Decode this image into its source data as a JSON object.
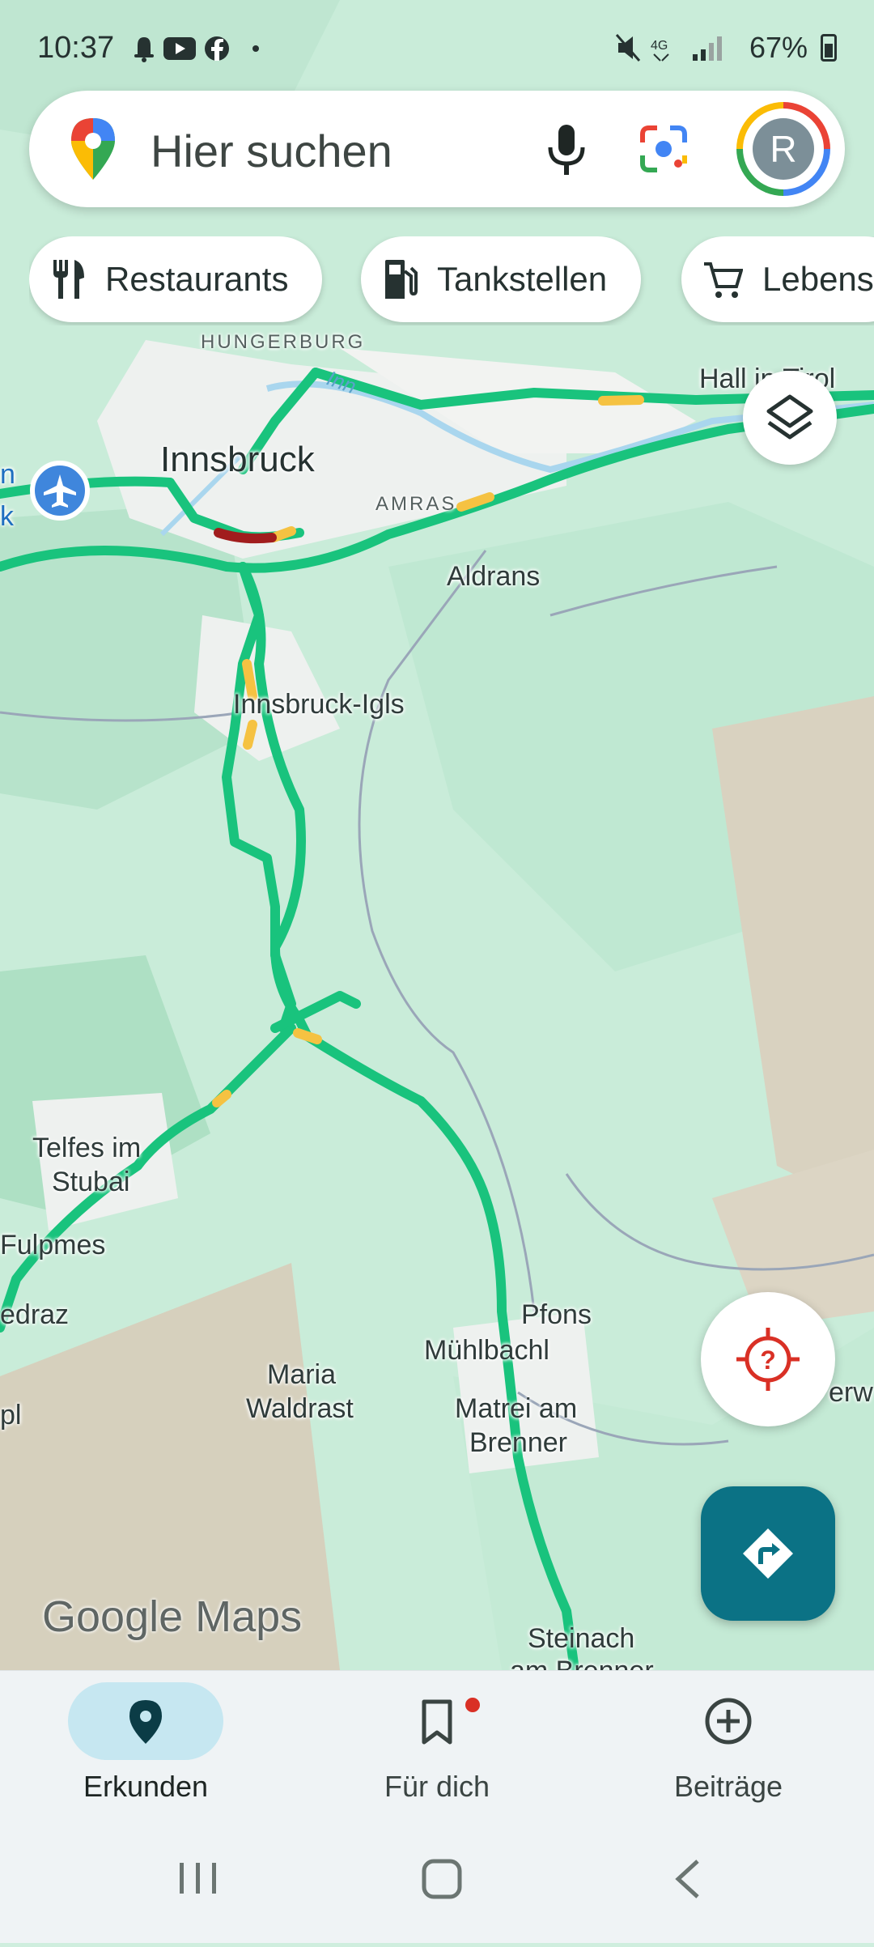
{
  "status_bar": {
    "time": "10:37",
    "left_icons": [
      "bell-icon",
      "youtube-icon",
      "facebook-icon",
      "dot-icon"
    ],
    "right_icons": [
      "mute-icon",
      "network-4g-icon",
      "signal-icon"
    ],
    "battery": "67%"
  },
  "search": {
    "placeholder": "Hier suchen",
    "avatar_letter": "R"
  },
  "chips": [
    {
      "label": "Restaurants",
      "icon": "restaurant-icon"
    },
    {
      "label": "Tankstellen",
      "icon": "gas-station-icon"
    },
    {
      "label": "Lebens",
      "icon": "cart-icon"
    }
  ],
  "map": {
    "labels": {
      "hungerburg": "HUNGERBURG",
      "inn": "Inn",
      "innsbruck": "Innsbruck",
      "hall": "Hall in Tirol",
      "amras": "AMRAS",
      "aldrans": "Aldrans",
      "airport_partial_1": "n",
      "airport_partial_2": "k",
      "igls": "Innsbruck-Igls",
      "telfes_1": "Telfes im",
      "telfes_2": "Stubai",
      "fulpmes": "Fulpmes",
      "medraz": "edraz",
      "pl": "pl",
      "pfons": "Pfons",
      "muehlbachl": "Mühlbachl",
      "maria_1": "Maria",
      "maria_2": "Waldrast",
      "matrei_1": "Matrei am",
      "matrei_2": "Brenner",
      "steinach_1": "Steinach",
      "steinach_2": "am Brenner",
      "erw": "erw"
    },
    "traffic_colors": {
      "free": "#19c37d",
      "slow": "#f5c242",
      "jam": "#a11d1d"
    },
    "logo": "Google Maps"
  },
  "bottom_nav": [
    {
      "label": "Erkunden",
      "icon": "location-pin-icon",
      "active": true
    },
    {
      "label": "Für dich",
      "icon": "bookmark-icon",
      "active": false,
      "badge": true
    },
    {
      "label": "Beiträge",
      "icon": "add-circle-icon",
      "active": false
    }
  ]
}
